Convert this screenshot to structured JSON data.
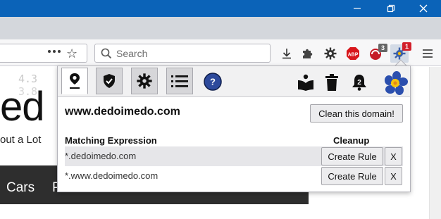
{
  "window": {
    "minimize_icon": "minimize-icon",
    "restore_icon": "restore-icon",
    "close_icon": "close-icon",
    "title_bar_color": "#0b63b8"
  },
  "toolbar": {
    "search_placeholder": "Search",
    "badges": {
      "ublock": "3",
      "cookie": "1",
      "abp": "ABP"
    },
    "icons": [
      "page-actions-icon",
      "bookmark-star-icon",
      "search-icon",
      "download-icon",
      "puzzle-icon",
      "settings-icon",
      "abp-icon",
      "ublock-icon",
      "cookie-autodelete-icon",
      "menu-icon"
    ]
  },
  "page": {
    "bg_number_1": "4.3",
    "bg_number_2": "3.8",
    "logo_fragment": "ed",
    "tagline_fragment": "out a Lot",
    "nav_items": [
      "Cars",
      "P"
    ]
  },
  "popup": {
    "tabs": [
      "location-pin-icon",
      "shield-check-icon",
      "gear-icon",
      "list-icon"
    ],
    "help_label": "?",
    "right_icons": [
      "reader-icon",
      "trash-icon",
      "bell-icon",
      "flower-logo-icon"
    ],
    "bell_count": "2",
    "domain": "www.dedoimedo.com",
    "clean_button": "Clean this domain!",
    "col_expression": "Matching Expression",
    "col_cleanup": "Cleanup",
    "rules": [
      {
        "expression": "*.dedoimedo.com",
        "create_label": "Create Rule",
        "remove_label": "X"
      },
      {
        "expression": "*.www.dedoimedo.com",
        "create_label": "Create Rule",
        "remove_label": "X"
      }
    ]
  }
}
